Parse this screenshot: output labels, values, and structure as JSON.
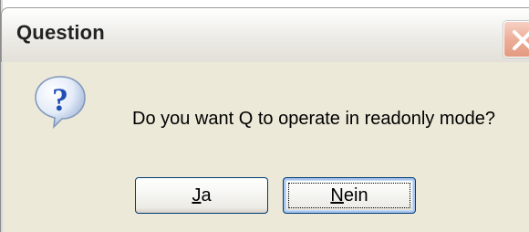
{
  "dialog": {
    "title": "Question",
    "message": "Do you want Q to operate in readonly mode?",
    "buttons": {
      "yes": {
        "label_mnemonic": "J",
        "label_rest": "a"
      },
      "no": {
        "label_mnemonic": "N",
        "label_rest": "ein"
      }
    },
    "icons": {
      "close": "close-icon",
      "question": "question-icon"
    }
  },
  "colors": {
    "client_background": "#ece9d8",
    "close_button": "#e39a80",
    "button_border": "#003c74",
    "question_blue": "#1f4fb5"
  }
}
